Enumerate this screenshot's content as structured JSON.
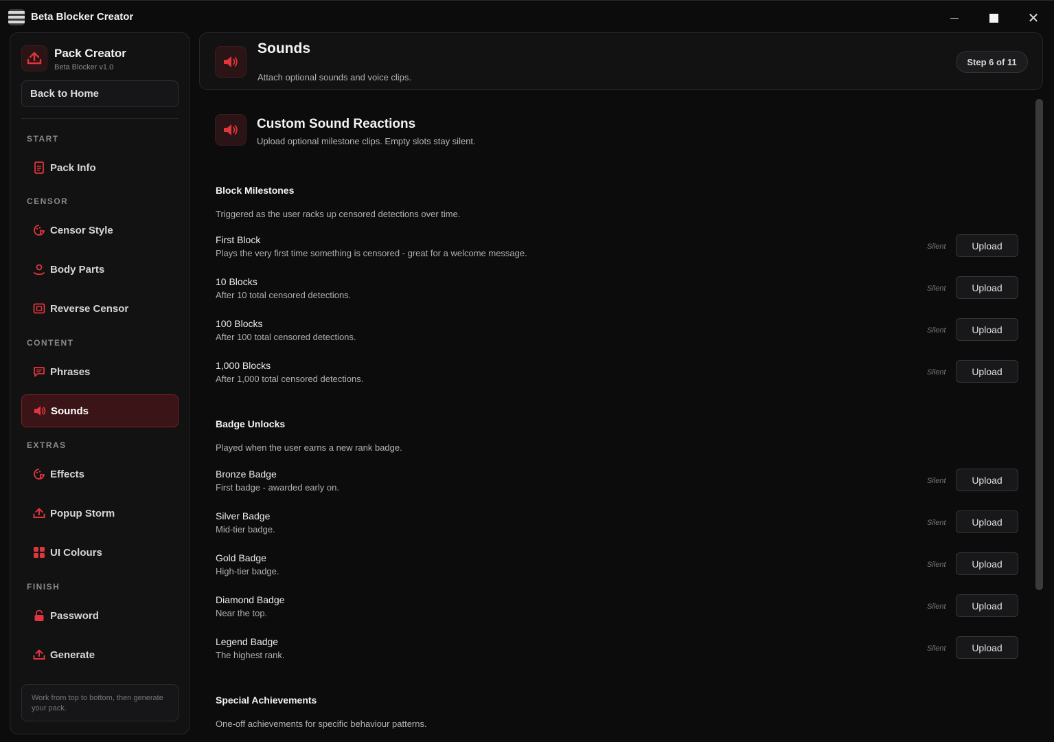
{
  "window": {
    "title": "Beta Blocker Creator"
  },
  "sidebar": {
    "brand_title": "Pack Creator",
    "brand_sub": "Beta Blocker v1.0",
    "back_label": "Back to Home",
    "sections": {
      "start": "START",
      "censor": "CENSOR",
      "content": "CONTENT",
      "extras": "EXTRAS",
      "finish": "FINISH"
    },
    "items": [
      {
        "label": "Pack Info",
        "icon": "document-icon"
      },
      {
        "label": "Censor Style",
        "icon": "palette-icon"
      },
      {
        "label": "Body Parts",
        "icon": "person-icon"
      },
      {
        "label": "Reverse Censor",
        "icon": "frame-icon"
      },
      {
        "label": "Phrases",
        "icon": "chat-icon"
      },
      {
        "label": "Sounds",
        "icon": "speaker-icon",
        "active": true
      },
      {
        "label": "Effects",
        "icon": "palette-icon"
      },
      {
        "label": "Popup Storm",
        "icon": "upload-icon"
      },
      {
        "label": "UI Colours",
        "icon": "grid-icon"
      },
      {
        "label": "Password",
        "icon": "lock-icon"
      },
      {
        "label": "Generate",
        "icon": "upload-icon"
      }
    ],
    "hint": "Work from top to bottom, then generate your pack."
  },
  "header": {
    "title": "Sounds",
    "subtitle": "Attach optional sounds and voice clips.",
    "step": "Step 6 of 11"
  },
  "main": {
    "section_title": "Custom Sound Reactions",
    "section_sub": "Upload optional milestone clips. Empty slots stay silent.",
    "status_label": "Silent",
    "upload_label": "Upload",
    "groups": [
      {
        "title": "Block Milestones",
        "desc": "Triggered as the user racks up censored detections over time.",
        "rows": [
          {
            "title": "First Block",
            "desc": "Plays the very first time something is censored - great for a welcome message."
          },
          {
            "title": "10 Blocks",
            "desc": "After 10 total censored detections."
          },
          {
            "title": "100 Blocks",
            "desc": "After 100 total censored detections."
          },
          {
            "title": "1,000 Blocks",
            "desc": "After 1,000 total censored detections."
          }
        ]
      },
      {
        "title": "Badge Unlocks",
        "desc": "Played when the user earns a new rank badge.",
        "rows": [
          {
            "title": "Bronze Badge",
            "desc": "First badge - awarded early on."
          },
          {
            "title": "Silver Badge",
            "desc": "Mid-tier badge."
          },
          {
            "title": "Gold Badge",
            "desc": "High-tier badge."
          },
          {
            "title": "Diamond Badge",
            "desc": "Near the top."
          },
          {
            "title": "Legend Badge",
            "desc": "The highest rank."
          }
        ]
      },
      {
        "title": "Special Achievements",
        "desc": "One-off achievements for specific behaviour patterns.",
        "rows": []
      }
    ]
  },
  "colors": {
    "accent": "#e0353d",
    "background": "#0c0c0d",
    "panel": "#121213"
  }
}
